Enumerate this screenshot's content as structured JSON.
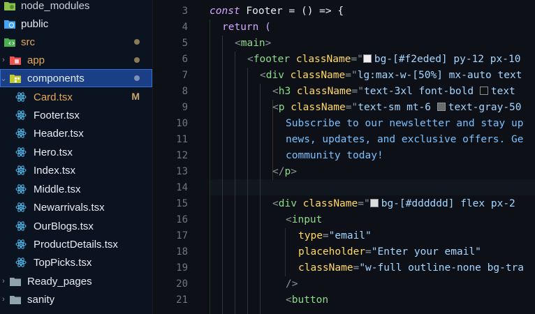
{
  "explorer": {
    "items": [
      {
        "label": "node_modules",
        "icon": "node-modules-folder-icon",
        "icon_color": "#8bc34a",
        "label_color": "#c9d1d9"
      },
      {
        "label": "public",
        "icon": "public-folder-icon",
        "icon_color": "#42a5f5",
        "label_color": "#e6edf3"
      },
      {
        "label": "src",
        "icon": "src-folder-icon",
        "icon_color": "#4caf50",
        "label_color": "#e6a95b",
        "badge": "dot"
      },
      {
        "label": "app",
        "icon": "app-folder-icon",
        "icon_color": "#ef5350",
        "label_color": "#e6a95b",
        "badge": "dot",
        "chevron": "right"
      },
      {
        "label": "components",
        "icon": "components-folder-icon",
        "icon_color": "#c0ca33",
        "label_color": "#e6edf3",
        "badge": "dot-blue",
        "chevron": "down",
        "selected": true
      },
      {
        "label": "Card.tsx",
        "icon": "react-icon",
        "icon_color": "#4fc3f7",
        "label_color": "#e6a95b",
        "badge": "M"
      },
      {
        "label": "Footer.tsx",
        "icon": "react-icon",
        "icon_color": "#4fc3f7",
        "label_color": "#e6edf3"
      },
      {
        "label": "Header.tsx",
        "icon": "react-icon",
        "icon_color": "#4fc3f7",
        "label_color": "#e6edf3"
      },
      {
        "label": "Hero.tsx",
        "icon": "react-icon",
        "icon_color": "#4fc3f7",
        "label_color": "#e6edf3"
      },
      {
        "label": "Index.tsx",
        "icon": "react-icon",
        "icon_color": "#4fc3f7",
        "label_color": "#e6edf3"
      },
      {
        "label": "Middle.tsx",
        "icon": "react-icon",
        "icon_color": "#4fc3f7",
        "label_color": "#e6edf3"
      },
      {
        "label": "Newarrivals.tsx",
        "icon": "react-icon",
        "icon_color": "#4fc3f7",
        "label_color": "#e6edf3"
      },
      {
        "label": "OurBlogs.tsx",
        "icon": "react-icon",
        "icon_color": "#4fc3f7",
        "label_color": "#e6edf3"
      },
      {
        "label": "ProductDetails.tsx",
        "icon": "react-icon",
        "icon_color": "#4fc3f7",
        "label_color": "#e6edf3"
      },
      {
        "label": "TopPicks.tsx",
        "icon": "react-icon",
        "icon_color": "#4fc3f7",
        "label_color": "#e6edf3"
      },
      {
        "label": "Ready_pages",
        "icon": "folder-icon",
        "icon_color": "#90a4ae",
        "label_color": "#e6edf3",
        "chevron": "right"
      },
      {
        "label": "sanity",
        "icon": "folder-icon",
        "icon_color": "#90a4ae",
        "label_color": "#e6edf3",
        "chevron": "right"
      }
    ]
  },
  "editor": {
    "line_numbers": [
      "3",
      "4",
      "5",
      "6",
      "7",
      "8",
      "9",
      "10",
      "11",
      "12",
      "13",
      "14",
      "15",
      "16",
      "17",
      "18",
      "19",
      "20",
      "21"
    ],
    "lines": {
      "l3": {
        "kw": "const",
        "name": " Footer ",
        "rest": "= () => {"
      },
      "l4": {
        "kw": "return",
        "rest": " ("
      },
      "l5": {
        "open": "<",
        "tag": "main",
        "close": ">"
      },
      "l6": {
        "open": "<",
        "tag": "footer",
        "attr": " className",
        "eq": "=\"",
        "swatch": "#f2eded",
        "value": "bg-[#f2eded] py-12 px-10"
      },
      "l7": {
        "open": "<",
        "tag": "div",
        "attr": " className",
        "eq": "=\"",
        "value": "lg:max-w-[50%] mx-auto text"
      },
      "l8": {
        "open": "<",
        "tag": "h3",
        "attr": " className",
        "eq": "=\"",
        "value_a": "text-3xl font-bold ",
        "swatch": "#111111",
        "value_b": "text"
      },
      "l9": {
        "open": "<",
        "tag": "p",
        "attr": " className",
        "eq": "=\"",
        "value_a": "text-sm mt-6 ",
        "swatch": "#6b6b6b",
        "value_b": "text-gray-50"
      },
      "l10": {
        "text": "Subscribe to our newsletter and stay up"
      },
      "l11": {
        "text": "news, updates, and exclusive offers. Ge"
      },
      "l12": {
        "text": "community today!"
      },
      "l13": {
        "open": "</",
        "tag": "p",
        "close": ">"
      },
      "l14": {
        "text": ""
      },
      "l15": {
        "open": "<",
        "tag": "div",
        "attr": " className",
        "eq": "=\"",
        "swatch": "#dddddd",
        "value": "bg-[#dddddd] flex px-2"
      },
      "l16": {
        "open": "<",
        "tag": "input"
      },
      "l17": {
        "attr": "type",
        "eq": "=",
        "value": "\"email\""
      },
      "l18": {
        "attr": "placeholder",
        "eq": "=",
        "value": "\"Enter your email\""
      },
      "l19": {
        "attr": "className",
        "eq": "=",
        "value": "\"w-full outline-none bg-tra"
      },
      "l20": {
        "close": "/>"
      },
      "l21": {
        "open": "<",
        "tag": "button"
      }
    }
  },
  "colors": {
    "sidebar_bg": "#0b1220",
    "editor_bg": "#0d1117",
    "selection": "#1b3f86",
    "keyword": "#d2a8ff",
    "tag": "#8ddb8c",
    "attribute": "#ffd866",
    "string": "#a5d6ff"
  }
}
